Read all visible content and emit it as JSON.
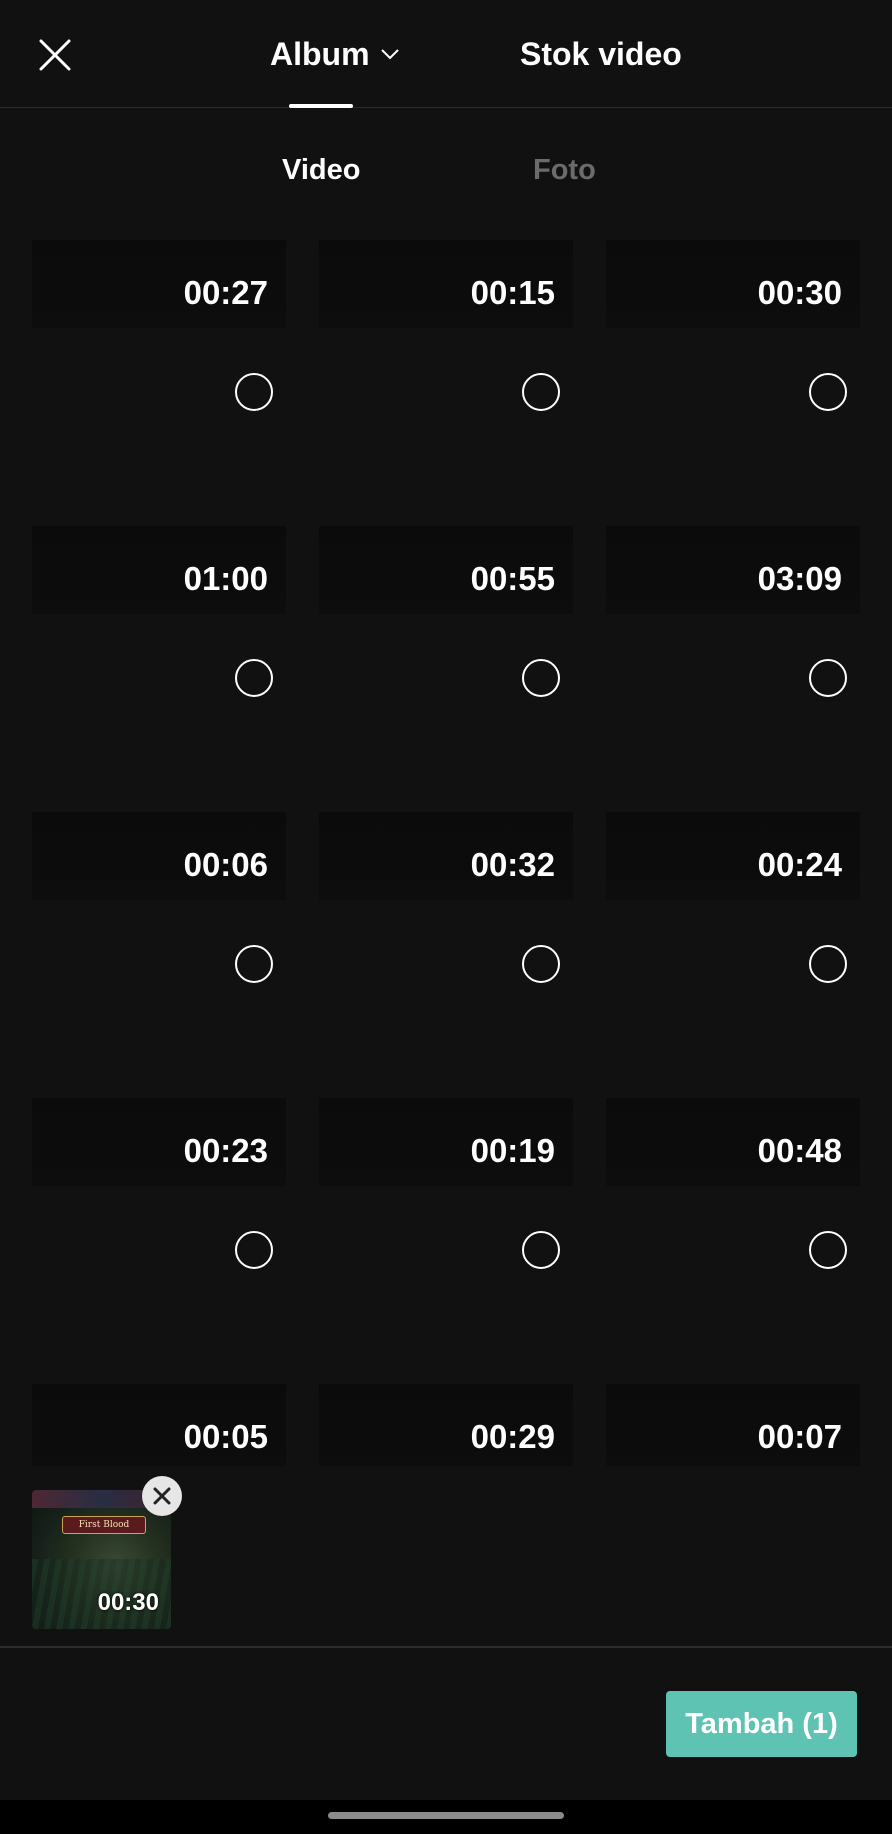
{
  "header": {
    "close_icon": "close-icon",
    "tabs": [
      {
        "label": "Album",
        "active": true,
        "icon": "chevron-down-icon"
      },
      {
        "label": "Stok video",
        "active": false
      }
    ]
  },
  "subtabs": [
    {
      "label": "Video",
      "active": true
    },
    {
      "label": "Foto",
      "active": false
    }
  ],
  "videos": [
    {
      "duration": "00:27"
    },
    {
      "duration": "00:15"
    },
    {
      "duration": "00:30"
    },
    {
      "duration": "01:00"
    },
    {
      "duration": "00:55"
    },
    {
      "duration": "03:09"
    },
    {
      "duration": "00:06"
    },
    {
      "duration": "00:32"
    },
    {
      "duration": "00:24"
    },
    {
      "duration": "00:23"
    },
    {
      "duration": "00:19"
    },
    {
      "duration": "00:48"
    },
    {
      "duration": "00:05"
    },
    {
      "duration": "00:29"
    },
    {
      "duration": "00:07"
    }
  ],
  "selection": {
    "items": [
      {
        "duration": "00:30",
        "banner": "First Blood"
      }
    ]
  },
  "add_button": {
    "label": "Tambah (1)"
  },
  "colors": {
    "background": "#111111",
    "accent": "#5ec3b2",
    "inactive_text": "#6b6b6b"
  }
}
